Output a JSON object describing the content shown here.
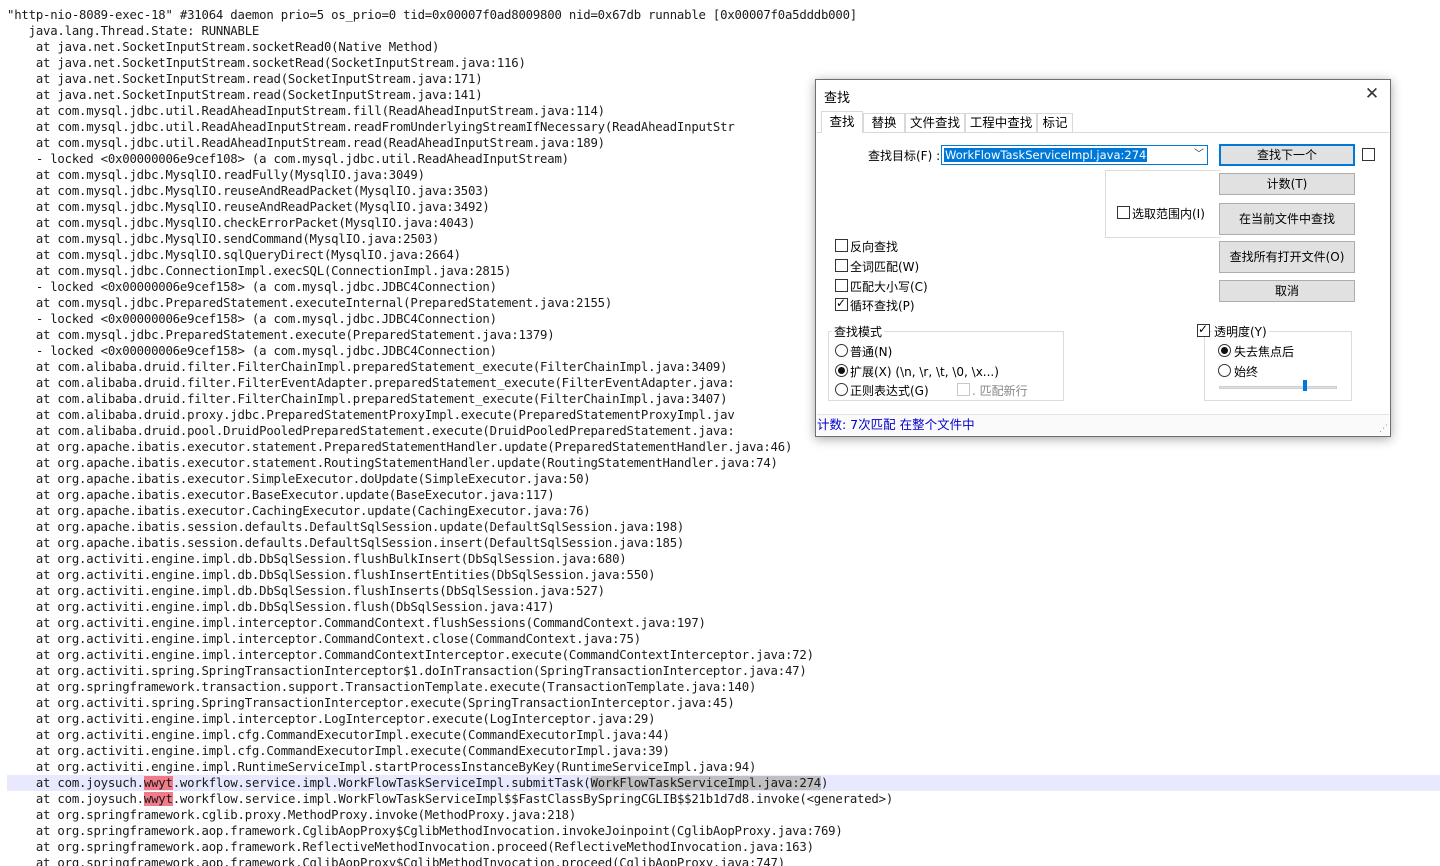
{
  "editor": {
    "lines": [
      "\"http-nio-8089-exec-18\" #31064 daemon prio=5 os_prio=0 tid=0x00007f0ad8009800 nid=0x67db runnable [0x00007f0a5dddb000]",
      "   java.lang.Thread.State: RUNNABLE",
      "    at java.net.SocketInputStream.socketRead0(Native Method)",
      "    at java.net.SocketInputStream.socketRead(SocketInputStream.java:116)",
      "    at java.net.SocketInputStream.read(SocketInputStream.java:171)",
      "    at java.net.SocketInputStream.read(SocketInputStream.java:141)",
      "    at com.mysql.jdbc.util.ReadAheadInputStream.fill(ReadAheadInputStream.java:114)",
      "    at com.mysql.jdbc.util.ReadAheadInputStream.readFromUnderlyingStreamIfNecessary(ReadAheadInputStr",
      "    at com.mysql.jdbc.util.ReadAheadInputStream.read(ReadAheadInputStream.java:189)",
      "    - locked <0x00000006e9cef108> (a com.mysql.jdbc.util.ReadAheadInputStream)",
      "    at com.mysql.jdbc.MysqlIO.readFully(MysqlIO.java:3049)",
      "    at com.mysql.jdbc.MysqlIO.reuseAndReadPacket(MysqlIO.java:3503)",
      "    at com.mysql.jdbc.MysqlIO.reuseAndReadPacket(MysqlIO.java:3492)",
      "    at com.mysql.jdbc.MysqlIO.checkErrorPacket(MysqlIO.java:4043)",
      "    at com.mysql.jdbc.MysqlIO.sendCommand(MysqlIO.java:2503)",
      "    at com.mysql.jdbc.MysqlIO.sqlQueryDirect(MysqlIO.java:2664)",
      "    at com.mysql.jdbc.ConnectionImpl.execSQL(ConnectionImpl.java:2815)",
      "    - locked <0x00000006e9cef158> (a com.mysql.jdbc.JDBC4Connection)",
      "    at com.mysql.jdbc.PreparedStatement.executeInternal(PreparedStatement.java:2155)",
      "    - locked <0x00000006e9cef158> (a com.mysql.jdbc.JDBC4Connection)",
      "    at com.mysql.jdbc.PreparedStatement.execute(PreparedStatement.java:1379)",
      "    - locked <0x00000006e9cef158> (a com.mysql.jdbc.JDBC4Connection)",
      "    at com.alibaba.druid.filter.FilterChainImpl.preparedStatement_execute(FilterChainImpl.java:3409)",
      "    at com.alibaba.druid.filter.FilterEventAdapter.preparedStatement_execute(FilterEventAdapter.java:",
      "    at com.alibaba.druid.filter.FilterChainImpl.preparedStatement_execute(FilterChainImpl.java:3407)",
      "    at com.alibaba.druid.proxy.jdbc.PreparedStatementProxyImpl.execute(PreparedStatementProxyImpl.jav",
      "    at com.alibaba.druid.pool.DruidPooledPreparedStatement.execute(DruidPooledPreparedStatement.java:",
      "    at org.apache.ibatis.executor.statement.PreparedStatementHandler.update(PreparedStatementHandler.java:46)",
      "    at org.apache.ibatis.executor.statement.RoutingStatementHandler.update(RoutingStatementHandler.java:74)",
      "    at org.apache.ibatis.executor.SimpleExecutor.doUpdate(SimpleExecutor.java:50)",
      "    at org.apache.ibatis.executor.BaseExecutor.update(BaseExecutor.java:117)",
      "    at org.apache.ibatis.executor.CachingExecutor.update(CachingExecutor.java:76)",
      "    at org.apache.ibatis.session.defaults.DefaultSqlSession.update(DefaultSqlSession.java:198)",
      "    at org.apache.ibatis.session.defaults.DefaultSqlSession.insert(DefaultSqlSession.java:185)",
      "    at org.activiti.engine.impl.db.DbSqlSession.flushBulkInsert(DbSqlSession.java:680)",
      "    at org.activiti.engine.impl.db.DbSqlSession.flushInsertEntities(DbSqlSession.java:550)",
      "    at org.activiti.engine.impl.db.DbSqlSession.flushInserts(DbSqlSession.java:527)",
      "    at org.activiti.engine.impl.db.DbSqlSession.flush(DbSqlSession.java:417)",
      "    at org.activiti.engine.impl.interceptor.CommandContext.flushSessions(CommandContext.java:197)",
      "    at org.activiti.engine.impl.interceptor.CommandContext.close(CommandContext.java:75)",
      "    at org.activiti.engine.impl.interceptor.CommandContextInterceptor.execute(CommandContextInterceptor.java:72)",
      "    at org.activiti.spring.SpringTransactionInterceptor$1.doInTransaction(SpringTransactionInterceptor.java:47)",
      "    at org.springframework.transaction.support.TransactionTemplate.execute(TransactionTemplate.java:140)",
      "    at org.activiti.spring.SpringTransactionInterceptor.execute(SpringTransactionInterceptor.java:45)",
      "    at org.activiti.engine.impl.interceptor.LogInterceptor.execute(LogInterceptor.java:29)",
      "    at org.activiti.engine.impl.cfg.CommandExecutorImpl.execute(CommandExecutorImpl.java:44)",
      "    at org.activiti.engine.impl.cfg.CommandExecutorImpl.execute(CommandExecutorImpl.java:39)",
      "    at org.activiti.engine.impl.RuntimeServiceImpl.startProcessInstanceByKey(RuntimeServiceImpl.java:94)"
    ],
    "special_lines": {
      "submit_line": {
        "prefix": "    at com.joysuch.",
        "match": "wwyt",
        "middle": ".workflow.service.impl.WorkFlowTaskServiceImpl.submitTask(",
        "selected": "WorkFlowTaskServiceImpl.java:274",
        "suffix": ")"
      },
      "cglib_line": {
        "prefix": "    at com.joysuch.",
        "match": "wwyt",
        "suffix": ".workflow.service.impl.WorkFlowTaskServiceImpl$$FastClassBySpringCGLIB$$21b1d7d8.invoke(<generated>)"
      }
    },
    "tail_lines": [
      "    at org.springframework.cglib.proxy.MethodProxy.invoke(MethodProxy.java:218)",
      "    at org.springframework.aop.framework.CglibAopProxy$CglibMethodInvocation.invokeJoinpoint(CglibAopProxy.java:769)",
      "    at org.springframework.aop.framework.ReflectiveMethodInvocation.proceed(ReflectiveMethodInvocation.java:163)",
      "    at org.springframework.aop.framework.CglibAopProxy$CglibMethodInvocation.proceed(CglibAopProxy.java:747)"
    ]
  },
  "dialog": {
    "title": "查找",
    "close_glyph": "✕",
    "tabs": [
      "查找",
      "替换",
      "文件查找",
      "工程中查找",
      "标记"
    ],
    "find_target_label": "查找目标(F) :",
    "find_target_value": "WorkFlowTaskServiceImpl.java:274",
    "buttons": {
      "find_next": "查找下一个",
      "count": "计数(T)",
      "find_in_current": "在当前文件中查找",
      "find_in_all_open": "查找所有打开文件(O)",
      "cancel": "取消"
    },
    "in_selection_label": "选取范围内(I)",
    "options": {
      "backward": "反向查找",
      "whole_word": "全词匹配(W)",
      "match_case": "匹配大小写(C)",
      "wrap_around": "循环查找(P)"
    },
    "search_mode": {
      "title": "查找模式",
      "normal": "普通(N)",
      "extended": "扩展(X) (\\n, \\r, \\t, \\0, \\x...)",
      "regex": "正则表达式(G)",
      "dot_newline": ". 匹配新行"
    },
    "transparency": {
      "label": "透明度(Y)",
      "on_lose_focus": "失去焦点后",
      "always": "始终",
      "level": 0.72
    },
    "status": "计数:  7次匹配 在整个文件中"
  }
}
